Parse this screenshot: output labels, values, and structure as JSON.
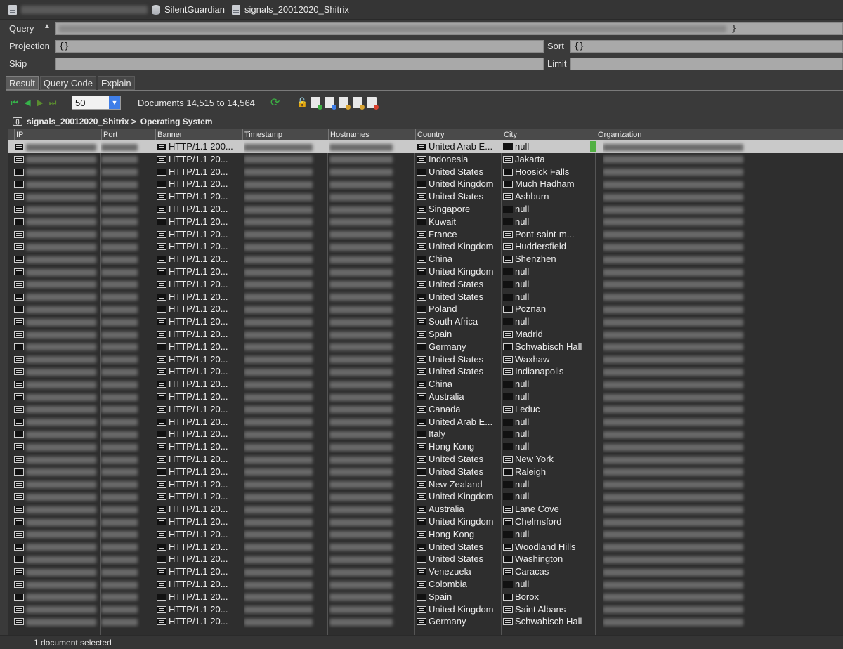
{
  "titlebar": {
    "database": "SilentGuardian",
    "collection": "signals_20012020_Shitrix"
  },
  "query": {
    "query_label": "Query",
    "query_value": "}",
    "projection_label": "Projection",
    "projection_value": "{}",
    "sort_label": "Sort",
    "sort_value": "{}",
    "skip_label": "Skip",
    "skip_value": "",
    "limit_label": "Limit",
    "limit_value": ""
  },
  "tabs": [
    {
      "label": "Result",
      "active": true
    },
    {
      "label": "Query Code",
      "active": false
    },
    {
      "label": "Explain",
      "active": false
    }
  ],
  "toolbar": {
    "page_size": "50",
    "documents_range": "Documents 14,515 to 14,564"
  },
  "breadcrumb": {
    "collection": "signals_20012020_Shitrix >",
    "field": "Operating System"
  },
  "grid": {
    "columns": [
      "IP",
      "Port",
      "Banner",
      "Timestamp",
      "Hostnames",
      "Country",
      "City",
      "Organization"
    ],
    "rows": [
      {
        "banner": "HTTP/1.1 200...",
        "country": "United Arab E...",
        "city": "null",
        "city_icon": "empty"
      },
      {
        "banner": "HTTP/1.1 20...",
        "country": "Indonesia",
        "city": "Jakarta",
        "city_icon": "doc"
      },
      {
        "banner": "HTTP/1.1 20...",
        "country": "United States",
        "city": "Hoosick Falls",
        "city_icon": "doc"
      },
      {
        "banner": "HTTP/1.1 20...",
        "country": "United Kingdom",
        "city": "Much Hadham",
        "city_icon": "doc"
      },
      {
        "banner": "HTTP/1.1 20...",
        "country": "United States",
        "city": "Ashburn",
        "city_icon": "doc"
      },
      {
        "banner": "HTTP/1.1 20...",
        "country": "Singapore",
        "city": "null",
        "city_icon": "empty"
      },
      {
        "banner": "HTTP/1.1 20...",
        "country": "Kuwait",
        "city": "null",
        "city_icon": "empty"
      },
      {
        "banner": "HTTP/1.1 20...",
        "country": "France",
        "city": "Pont-saint-m...",
        "city_icon": "doc"
      },
      {
        "banner": "HTTP/1.1 20...",
        "country": "United Kingdom",
        "city": "Huddersfield",
        "city_icon": "doc"
      },
      {
        "banner": "HTTP/1.1 20...",
        "country": "China",
        "city": "Shenzhen",
        "city_icon": "doc"
      },
      {
        "banner": "HTTP/1.1 20...",
        "country": "United Kingdom",
        "city": "null",
        "city_icon": "empty"
      },
      {
        "banner": "HTTP/1.1 20...",
        "country": "United States",
        "city": "null",
        "city_icon": "empty"
      },
      {
        "banner": "HTTP/1.1 20...",
        "country": "United States",
        "city": "null",
        "city_icon": "empty"
      },
      {
        "banner": "HTTP/1.1 20...",
        "country": "Poland",
        "city": "Poznan",
        "city_icon": "doc"
      },
      {
        "banner": "HTTP/1.1 20...",
        "country": "South Africa",
        "city": "null",
        "city_icon": "empty"
      },
      {
        "banner": "HTTP/1.1 20...",
        "country": "Spain",
        "city": "Madrid",
        "city_icon": "doc"
      },
      {
        "banner": "HTTP/1.1 20...",
        "country": "Germany",
        "city": "Schwabisch Hall",
        "city_icon": "doc"
      },
      {
        "banner": "HTTP/1.1 20...",
        "country": "United States",
        "city": "Waxhaw",
        "city_icon": "doc"
      },
      {
        "banner": "HTTP/1.1 20...",
        "country": "United States",
        "city": "Indianapolis",
        "city_icon": "doc"
      },
      {
        "banner": "HTTP/1.1 20...",
        "country": "China",
        "city": "null",
        "city_icon": "empty"
      },
      {
        "banner": "HTTP/1.1 20...",
        "country": "Australia",
        "city": "null",
        "city_icon": "empty"
      },
      {
        "banner": "HTTP/1.1 20...",
        "country": "Canada",
        "city": "Leduc",
        "city_icon": "doc"
      },
      {
        "banner": "HTTP/1.1 20...",
        "country": "United Arab E...",
        "city": "null",
        "city_icon": "empty"
      },
      {
        "banner": "HTTP/1.1 20...",
        "country": "Italy",
        "city": "null",
        "city_icon": "empty"
      },
      {
        "banner": "HTTP/1.1 20...",
        "country": "Hong Kong",
        "city": "null",
        "city_icon": "empty"
      },
      {
        "banner": "HTTP/1.1 20...",
        "country": "United States",
        "city": "New York",
        "city_icon": "doc"
      },
      {
        "banner": "HTTP/1.1 20...",
        "country": "United States",
        "city": "Raleigh",
        "city_icon": "doc"
      },
      {
        "banner": "HTTP/1.1 20...",
        "country": "New Zealand",
        "city": "null",
        "city_icon": "empty"
      },
      {
        "banner": "HTTP/1.1 20...",
        "country": "United Kingdom",
        "city": "null",
        "city_icon": "empty"
      },
      {
        "banner": "HTTP/1.1 20...",
        "country": "Australia",
        "city": "Lane Cove",
        "city_icon": "doc"
      },
      {
        "banner": "HTTP/1.1 20...",
        "country": "United Kingdom",
        "city": "Chelmsford",
        "city_icon": "doc"
      },
      {
        "banner": "HTTP/1.1 20...",
        "country": "Hong Kong",
        "city": "null",
        "city_icon": "empty"
      },
      {
        "banner": "HTTP/1.1 20...",
        "country": "United States",
        "city": "Woodland Hills",
        "city_icon": "doc"
      },
      {
        "banner": "HTTP/1.1 20...",
        "country": "United States",
        "city": "Washington",
        "city_icon": "doc"
      },
      {
        "banner": "HTTP/1.1 20...",
        "country": "Venezuela",
        "city": "Caracas",
        "city_icon": "doc"
      },
      {
        "banner": "HTTP/1.1 20...",
        "country": "Colombia",
        "city": "null",
        "city_icon": "empty"
      },
      {
        "banner": "HTTP/1.1 20...",
        "country": "Spain",
        "city": "Borox",
        "city_icon": "doc"
      },
      {
        "banner": "HTTP/1.1 20...",
        "country": "United Kingdom",
        "city": "Saint Albans",
        "city_icon": "doc"
      },
      {
        "banner": "HTTP/1.1 20...",
        "country": "Germany",
        "city": "Schwabisch Hall",
        "city_icon": "doc"
      }
    ]
  },
  "status": {
    "text": "1 document selected"
  },
  "colors": {
    "background": "#3a3a3a",
    "grid_background": "#2e2e2e",
    "selected_row": "#c9c9c9",
    "nav_green": "#36b34a",
    "dropdown_blue": "#3f7ee8"
  }
}
